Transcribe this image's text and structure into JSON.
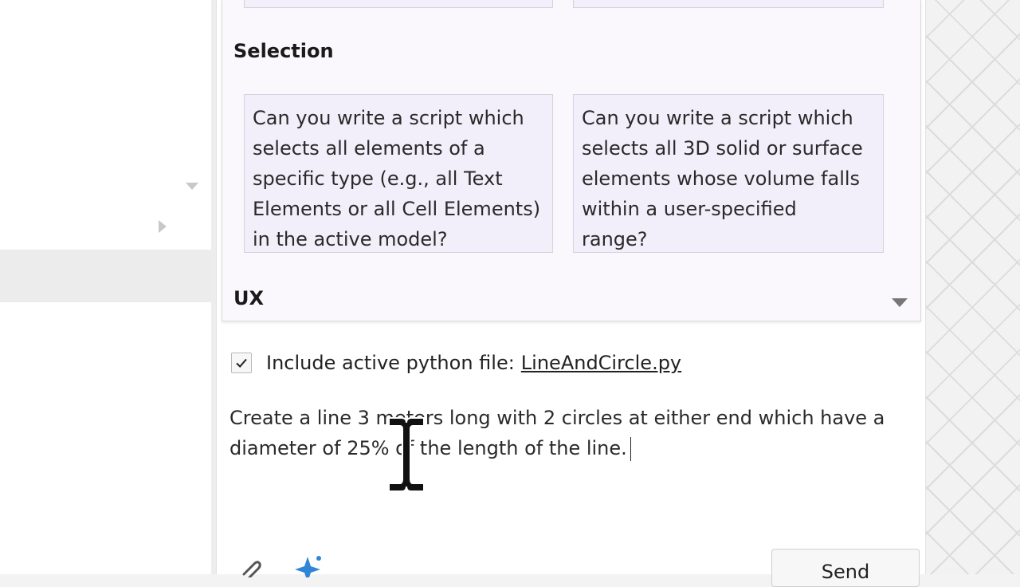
{
  "prompts": {
    "sections": [
      {
        "title": "Selection",
        "cards": [
          {
            "lines": [
              "Can you write a script which",
              "selects all elements of a",
              "specific type (e.g., all Text",
              "Elements or all Cell Elements)",
              "in the active model?"
            ]
          },
          {
            "lines": [
              "Can you write a script which",
              "selects all 3D solid or surface",
              "elements whose volume falls",
              "within a user-specified",
              "range?"
            ]
          }
        ]
      },
      {
        "title": "UX"
      }
    ]
  },
  "include": {
    "checked": true,
    "label": "Include active python file:",
    "file": "LineAndCircle.py"
  },
  "prompt_input": {
    "value": "Create a line 3 meters long with 2 circles at either end which have a diameter of 25% of the length of the line."
  },
  "toolbar": {
    "send_label": "Send",
    "icons": [
      "paperclip-icon",
      "sparkle-icon"
    ]
  }
}
